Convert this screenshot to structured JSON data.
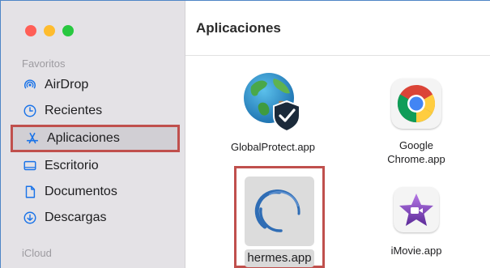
{
  "sidebar": {
    "favorites_label": "Favoritos",
    "items": [
      {
        "label": "AirDrop",
        "icon": "airdrop-icon"
      },
      {
        "label": "Recientes",
        "icon": "clock-icon"
      },
      {
        "label": "Aplicaciones",
        "icon": "applications-icon",
        "selected": true
      },
      {
        "label": "Escritorio",
        "icon": "desktop-icon"
      },
      {
        "label": "Documentos",
        "icon": "document-icon"
      },
      {
        "label": "Descargas",
        "icon": "download-icon"
      }
    ],
    "icloud_label": "iCloud"
  },
  "main": {
    "title": "Aplicaciones",
    "apps": [
      {
        "name": "GlobalProtect.app",
        "icon": "globalprotect-icon"
      },
      {
        "name_line1": "Google",
        "name_line2": "Chrome.app",
        "icon": "chrome-icon"
      },
      {
        "name": "hermes.app",
        "icon": "hermes-icon",
        "highlighted": true
      },
      {
        "name": "iMovie.app",
        "icon": "imovie-icon"
      }
    ]
  },
  "colors": {
    "sidebar_bg": "#e4e2e6",
    "highlight_border": "#c0504d",
    "accent": "#1a73e8"
  }
}
